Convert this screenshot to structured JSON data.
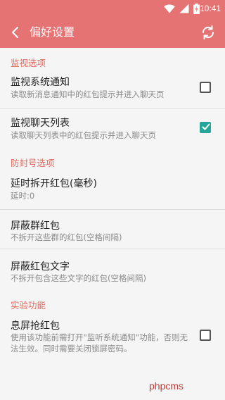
{
  "status_bar": {
    "time": "10:41",
    "icons": [
      "wifi-icon",
      "signal-icon",
      "battery-icon"
    ]
  },
  "app_bar": {
    "title": "偏好设置",
    "back_icon": "arrow-left-icon",
    "refresh_icon": "refresh-icon"
  },
  "sections": {
    "monitor": {
      "header": "监视选项",
      "notification": {
        "title": "监视系统通知",
        "summary": "读取新消息通知中的红包提示并进入聊天页",
        "checked": false
      },
      "chat_list": {
        "title": "监视聊天列表",
        "summary": "读取聊天列表中的红包提示并进入聊天页",
        "checked": true
      }
    },
    "anti_ban": {
      "header": "防封号选项",
      "delay": {
        "title": "延时拆开红包(毫秒)",
        "summary": "延时:0"
      },
      "block_groups": {
        "title": "屏蔽群红包",
        "summary": "不拆开这些群的红包(空格间隔)"
      },
      "block_text": {
        "title": "屏蔽红包文字",
        "summary": "不拆开包含这些文字的红包(空格间隔)"
      }
    },
    "experimental": {
      "header": "实验功能",
      "screen_off": {
        "title": "息屏抢红包",
        "summary": "使用该功能前需打开\"监听系统通知\"功能，否则无法生效。同时需要关闭锁屏密码。",
        "checked": false
      }
    }
  },
  "watermark": "phpcms",
  "colors": {
    "primary": "#e57373",
    "accent": "#26a69a",
    "section_header": "#e06a5e"
  }
}
